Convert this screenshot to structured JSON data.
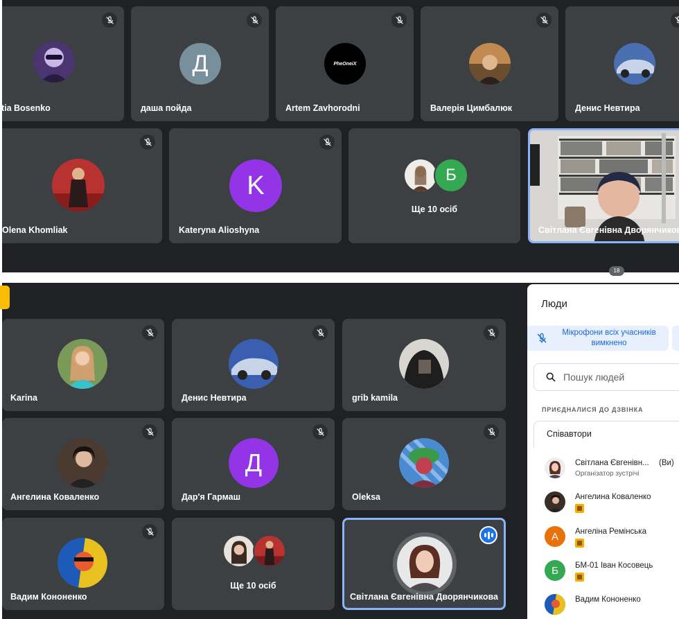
{
  "top_call": {
    "row1": [
      {
        "name": "atia Bosenko",
        "avatar": "photo",
        "muted": true
      },
      {
        "name": "даша пойда",
        "avatar": "letter",
        "letter": "Д",
        "muted": true
      },
      {
        "name": "Artem Zavhorodni",
        "avatar": "logo",
        "logo_text": "PheOneiX",
        "muted": true
      },
      {
        "name": "Валерія Цимбалюк",
        "avatar": "photo",
        "muted": true
      },
      {
        "name": "Денис Невтира",
        "avatar": "photo",
        "muted": true
      }
    ],
    "row2": [
      {
        "name": "Olena Khomliak",
        "avatar": "photo",
        "muted": true
      },
      {
        "name": "Kateryna Alioshyna",
        "avatar": "letter",
        "letter": "K",
        "muted": true
      }
    ],
    "more": {
      "label": "Ще 10 осіб",
      "letter": "Б"
    },
    "presenter": {
      "name": "Світлана Євгенівна Дворянчикова"
    },
    "badge": "18"
  },
  "bottom_call": {
    "tiles": [
      {
        "name": "Karina",
        "avatar": "photo",
        "muted": true
      },
      {
        "name": "Денис Невтира",
        "avatar": "photo",
        "muted": true
      },
      {
        "name": "grib kamila",
        "avatar": "photo",
        "muted": true
      },
      {
        "name": "Ангелина Коваленко",
        "avatar": "photo",
        "muted": true
      },
      {
        "name": "Дар'я Гармаш",
        "avatar": "letter",
        "letter": "Д",
        "muted": true
      },
      {
        "name": "Oleksa",
        "avatar": "photo",
        "muted": true
      },
      {
        "name": "Вадим Кононенко",
        "avatar": "photo",
        "muted": true
      }
    ],
    "more": {
      "label": "Ще 10 осіб"
    },
    "speaker": {
      "name": "Світлана Євгенівна Дворянчикова"
    }
  },
  "people_panel": {
    "title": "Люди",
    "mute_all_label": "Мікрофони всіх учасників вимкнено",
    "search_placeholder": "Пошук людей",
    "section_label": "ПРИЄДНАЛИСЯ ДО ДЗВІНКА",
    "group_label": "Співавтори",
    "people": [
      {
        "name": "Світлана Євгенівн...",
        "you": "(Ви)",
        "subtitle": "Організатор зустрічі"
      },
      {
        "name": "Ангелина Коваленко"
      },
      {
        "name": "Ангеліна Ремінська",
        "letter": "А"
      },
      {
        "name": "БМ-01 Іван Косовець",
        "letter": "Б"
      },
      {
        "name": "Вадим Кононенко"
      }
    ]
  },
  "colors": {
    "background": "#202124",
    "tile": "#3c4043",
    "active_border": "#8ab4f8",
    "purple": "#9334e6",
    "green": "#34a853",
    "orange": "#e8710a",
    "grey_avatar": "#78909c",
    "accent_blue": "#1a73e8"
  }
}
